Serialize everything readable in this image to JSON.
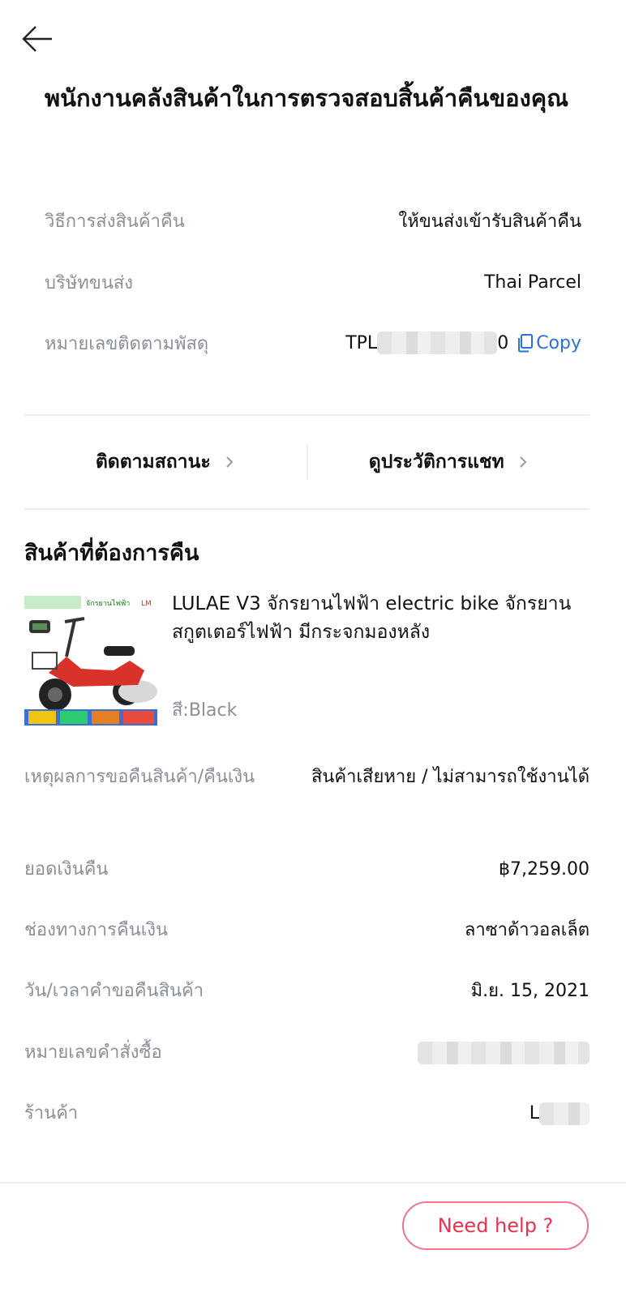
{
  "header": {
    "back_icon": "arrow-left-icon"
  },
  "status": {
    "title": "พนักงานคลังสินค้าในการตรวจสอบสิ้นค้าคืนของคุณ"
  },
  "shipping": {
    "method_label": "วิธีการส่งสินค้าคืน",
    "method_value": "ให้ขนส่งเข้ารับสินค้าคืน",
    "carrier_label": "บริษัทขนส่ง",
    "carrier_value": "Thai Parcel",
    "tracking_label": "หมายเลขติดตามพัสดุ",
    "tracking_prefix": "TPL",
    "tracking_suffix": "0",
    "copy_label": "Copy"
  },
  "actions": {
    "track_status": "ติดตามสถานะ",
    "chat_history": "ดูประวัติการแชท"
  },
  "return_items": {
    "section_title": "สินค้าที่ต้องการคืน",
    "product": {
      "name": "LULAE V3 จักรยานไฟฟ้า electric bike จักรยาน สกูตเตอร์ไฟฟ้า มีกระจกมองหลัง",
      "variant": "สี:Black",
      "image_banner": "จักรยานไฟฟ้า",
      "image_logo": "LM"
    }
  },
  "details": {
    "reason_label": "เหตุผลการขอคืนสินค้า/คืนเงิน",
    "reason_value": "สินค้าเสียหาย / ไม่สามารถใช้งานได้",
    "refund_amount_label": "ยอดเงินคืน",
    "refund_amount_value": "฿7,259.00",
    "refund_channel_label": "ช่องทางการคืนเงิน",
    "refund_channel_value": "ลาซาด้าวอลเล็ต",
    "request_date_label": "วัน/เวลาคำขอคืนสินค้า",
    "request_date_value": "มิ.ย. 15, 2021",
    "order_number_label": "หมายเลขคำสั่งซื้อ",
    "shop_label": "ร้านค้า",
    "shop_value_visible": "L"
  },
  "footer": {
    "help_label": "Need help ?"
  },
  "colors": {
    "accent_red": "#e8324f",
    "link_blue": "#2a72d8",
    "label_gray": "#8a8f99"
  }
}
